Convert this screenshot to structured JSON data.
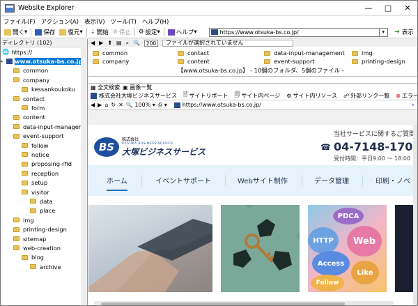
{
  "window": {
    "title": "Website Explorer",
    "min": "—",
    "max": "□",
    "close": "✕"
  },
  "menu": [
    "ファイル(F)",
    "アクション(A)",
    "表示(V)",
    "ツール(T)",
    "ヘルプ(H)"
  ],
  "toolbar": {
    "open": "開く",
    "save": "保存",
    "restore": "復元",
    "start": "開始",
    "stop": "停止",
    "settings": "設定",
    "help": "ヘルプ",
    "address": "https://www.otsuka-bs.co.jp/",
    "go": "表示"
  },
  "left": {
    "header": "ディレクトリ (102)",
    "tree": [
      {
        "label": "https://",
        "depth": 0,
        "kind": "root"
      },
      {
        "label": "www.otsuka-bs.co.jp",
        "depth": 1,
        "kind": "selected"
      },
      {
        "label": "common",
        "depth": 2
      },
      {
        "label": "company",
        "depth": 2
      },
      {
        "label": "kessankoukoku",
        "depth": 3
      },
      {
        "label": "contact",
        "depth": 2
      },
      {
        "label": "form",
        "depth": 3
      },
      {
        "label": "content",
        "depth": 2
      },
      {
        "label": "data-input-management",
        "depth": 2
      },
      {
        "label": "event-support",
        "depth": 2
      },
      {
        "label": "follow",
        "depth": 3
      },
      {
        "label": "notice",
        "depth": 3
      },
      {
        "label": "proposing-rfid",
        "depth": 3
      },
      {
        "label": "reception",
        "depth": 3
      },
      {
        "label": "setup",
        "depth": 3
      },
      {
        "label": "visitor",
        "depth": 3
      },
      {
        "label": "data",
        "depth": 4
      },
      {
        "label": "place",
        "depth": 4
      },
      {
        "label": "img",
        "depth": 2
      },
      {
        "label": "printing-design",
        "depth": 2
      },
      {
        "label": "sitemap",
        "depth": 2
      },
      {
        "label": "web-creation",
        "depth": 2
      },
      {
        "label": "blog",
        "depth": 3
      },
      {
        "label": "archive",
        "depth": 4
      }
    ]
  },
  "nav2": {
    "zoom": "200",
    "status": "ファイルが選択されていません"
  },
  "files": [
    {
      "name": "common"
    },
    {
      "name": "contact"
    },
    {
      "name": "data-input-management"
    },
    {
      "name": "img"
    },
    {
      "name": "company"
    },
    {
      "name": "content"
    },
    {
      "name": "event-support"
    },
    {
      "name": "printing-design"
    }
  ],
  "summary": "【www.otsuka-bs.co.jp】 - 10個のフォルダ、5個のファイル -",
  "tabs": {
    "fulltext": "全文検索",
    "images": "画像一覧"
  },
  "section": {
    "site": "株式会社大塚ビジネスサービス",
    "report": "サイトリポート",
    "pages": "サイト内ページ",
    "resources": "サイト内リソース",
    "external": "外部リンク一覧",
    "errors": "エラー一覧"
  },
  "browser": {
    "zoom": "100%",
    "url": "https://www.otsuka-bs.co.jp/"
  },
  "page": {
    "logo_mark": "BS",
    "logo_kaisha": "株式会社",
    "logo_en": "OTSUKA BUSINESS SERVICE",
    "logo_name": "大塚ビジネスサービス",
    "contact_q": "当社サービスに関するご質問・ご",
    "phone": "04-7148-170",
    "hours": "受付時間：平日9:00 〜 18:00",
    "nav": [
      "ホーム",
      "イベントサポート",
      "Webサイト制作",
      "データ管理",
      "印刷・ノベ"
    ],
    "bubbles": [
      "PDCA",
      "HTTP",
      "Web",
      "Access",
      "Like",
      "Follow"
    ]
  }
}
